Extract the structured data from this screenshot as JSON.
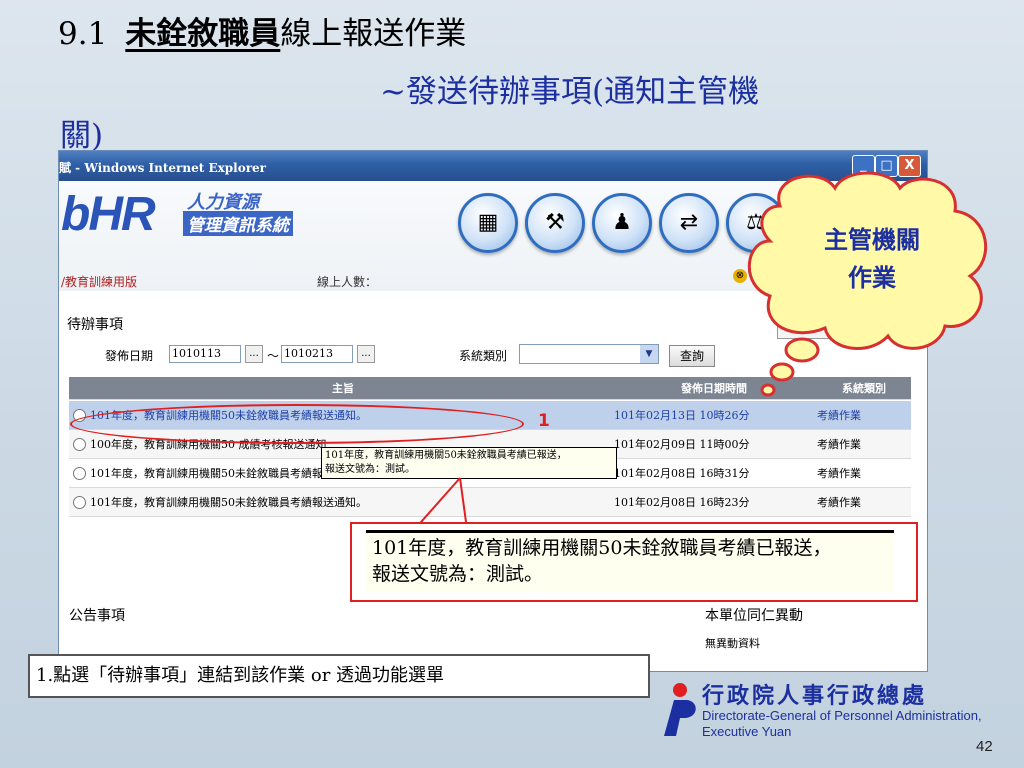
{
  "slide": {
    "title_num": "9.1",
    "title_emph": "未銓敘職員",
    "title_rest": "線上報送作業",
    "subtitle_line1": "~發送待辦事項(通知主管機",
    "subtitle_line2": "關)",
    "page_number": "42"
  },
  "window": {
    "title": "賦 - Windows Internet Explorer",
    "minimize": "_",
    "maximize": "□",
    "close": "X"
  },
  "app": {
    "logo_text": "bHR",
    "logo_line1": "人力資源",
    "logo_line2": "管理資訊系統",
    "edition": "/教育訓練用版",
    "online_label": "線上人數：",
    "nav_icons": [
      "org-chart-icon",
      "tools-icon",
      "person-icon",
      "transfer-icon",
      "scales-icon"
    ],
    "warn_glyph": "⊗"
  },
  "todo": {
    "heading": "待辦事項",
    "date_label": "發佈日期",
    "date_from": "1010113",
    "date_to": "1010213",
    "dots": "...",
    "tilde": "～",
    "system_label": "系統類別",
    "system_value": "",
    "query_button": "查詢",
    "columns": [
      "主旨",
      "發佈日期時間",
      "系統類別"
    ],
    "rows": [
      {
        "subject": "101年度，教育訓練用機關50未銓敘職員考績報送通知。",
        "datetime": "101年02月13日 10時26分",
        "category": "考績作業"
      },
      {
        "subject": "100年度，教育訓練用機關50 成績考核報送通知",
        "datetime": "101年02月09日 11時00分",
        "category": "考績作業"
      },
      {
        "subject": "101年度，教育訓練用機關50未銓敘職員考績報送通知",
        "datetime": "101年02月08日 16時31分",
        "category": "考績作業"
      },
      {
        "subject": "101年度，教育訓練用機關50未銓敘職員考績報送通知。",
        "datetime": "101年02月08日 16時23分",
        "category": "考績作業"
      }
    ],
    "tooltip_line1": "101年度，教育訓練用機關50未銓敘職員考績已報送，",
    "tooltip_line2": "報送文號為：測試。"
  },
  "announcements": {
    "heading": "公告事項"
  },
  "staff_changes": {
    "heading": "本單位同仁異動",
    "empty": "無異動資料"
  },
  "callouts": {
    "number": "1",
    "cloud_line1": "主管機關",
    "cloud_line2": "作業",
    "zoom_line1": "101年度，教育訓練用機關50未銓敘職員考績已報送，",
    "zoom_line2": "報送文號為：測試。",
    "instruction": "1.點選「待辦事項」連結到該作業 or 透過功能選單"
  },
  "footer": {
    "org_cn": "行政院人事行政總處",
    "org_en1": "Directorate-General of Personnel Administration,",
    "org_en2": "Executive Yuan"
  },
  "colors": {
    "accent": "#1c2fa0",
    "highlight": "#e02020",
    "cloud": "#fff9a8"
  }
}
